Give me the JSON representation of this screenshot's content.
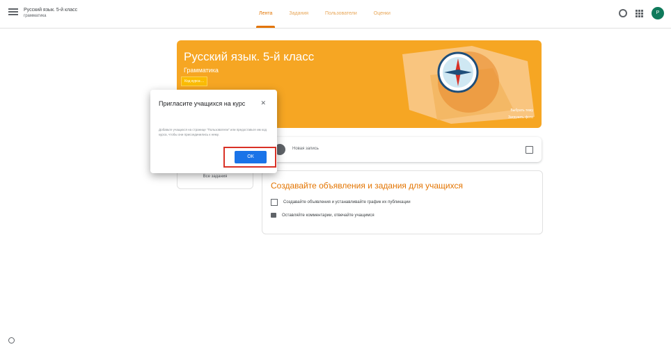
{
  "header": {
    "course_title": "Русский язык. 5-й класс",
    "course_subtitle": "грамматика",
    "tabs": [
      "Лента",
      "Задания",
      "Пользователи",
      "Оценки"
    ],
    "avatar_initial": "Р"
  },
  "banner": {
    "title": "Русский язык. 5-й класс",
    "subtitle": "Грамматика",
    "course_code": "Код курса  ...",
    "link_select": "Выбрать тему",
    "link_upload": "Загрузить фото"
  },
  "left_card": {
    "text": "Все задания"
  },
  "share": {
    "placeholder": "Новая запись"
  },
  "empty_stream": {
    "title": "Создавайте объявления и задания для учащихся",
    "item1": "Создавайте объявления и устанавливайте график их публикации",
    "item2": "Оставляйте комментарии, отвечайте учащимся"
  },
  "dialog": {
    "title": "Пригласите учащихся на курс",
    "body": "Добавьте учащихся на странице \"Пользователи\" или предоставьте им код курса, чтобы они присоединились к нему.",
    "ok_label": "ОК"
  },
  "colors": {
    "accent": "#e37400",
    "banner": "#f6a623",
    "button": "#1a73e8",
    "highlight": "#d93025"
  }
}
